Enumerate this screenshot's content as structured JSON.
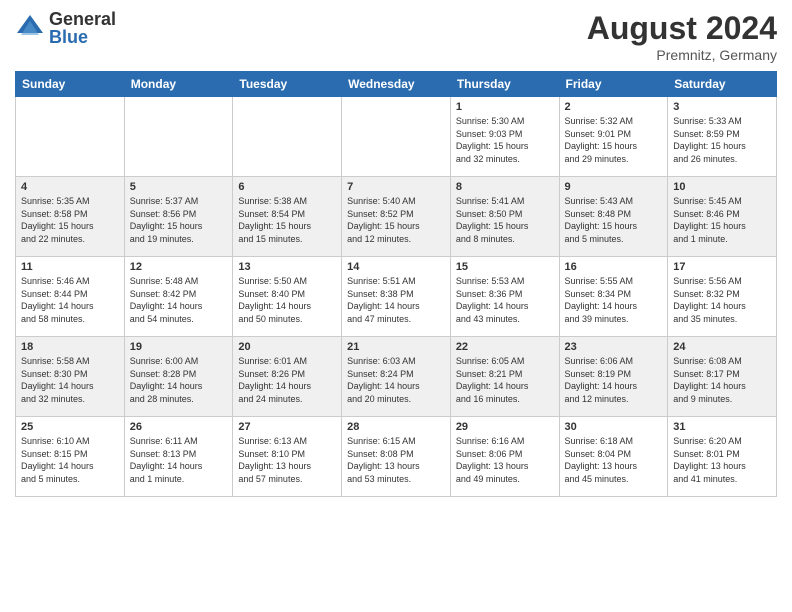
{
  "header": {
    "logo_general": "General",
    "logo_blue": "Blue",
    "month_year": "August 2024",
    "location": "Premnitz, Germany"
  },
  "weekdays": [
    "Sunday",
    "Monday",
    "Tuesday",
    "Wednesday",
    "Thursday",
    "Friday",
    "Saturday"
  ],
  "weeks": [
    [
      {
        "day": "",
        "info": ""
      },
      {
        "day": "",
        "info": ""
      },
      {
        "day": "",
        "info": ""
      },
      {
        "day": "",
        "info": ""
      },
      {
        "day": "1",
        "info": "Sunrise: 5:30 AM\nSunset: 9:03 PM\nDaylight: 15 hours\nand 32 minutes."
      },
      {
        "day": "2",
        "info": "Sunrise: 5:32 AM\nSunset: 9:01 PM\nDaylight: 15 hours\nand 29 minutes."
      },
      {
        "day": "3",
        "info": "Sunrise: 5:33 AM\nSunset: 8:59 PM\nDaylight: 15 hours\nand 26 minutes."
      }
    ],
    [
      {
        "day": "4",
        "info": "Sunrise: 5:35 AM\nSunset: 8:58 PM\nDaylight: 15 hours\nand 22 minutes."
      },
      {
        "day": "5",
        "info": "Sunrise: 5:37 AM\nSunset: 8:56 PM\nDaylight: 15 hours\nand 19 minutes."
      },
      {
        "day": "6",
        "info": "Sunrise: 5:38 AM\nSunset: 8:54 PM\nDaylight: 15 hours\nand 15 minutes."
      },
      {
        "day": "7",
        "info": "Sunrise: 5:40 AM\nSunset: 8:52 PM\nDaylight: 15 hours\nand 12 minutes."
      },
      {
        "day": "8",
        "info": "Sunrise: 5:41 AM\nSunset: 8:50 PM\nDaylight: 15 hours\nand 8 minutes."
      },
      {
        "day": "9",
        "info": "Sunrise: 5:43 AM\nSunset: 8:48 PM\nDaylight: 15 hours\nand 5 minutes."
      },
      {
        "day": "10",
        "info": "Sunrise: 5:45 AM\nSunset: 8:46 PM\nDaylight: 15 hours\nand 1 minute."
      }
    ],
    [
      {
        "day": "11",
        "info": "Sunrise: 5:46 AM\nSunset: 8:44 PM\nDaylight: 14 hours\nand 58 minutes."
      },
      {
        "day": "12",
        "info": "Sunrise: 5:48 AM\nSunset: 8:42 PM\nDaylight: 14 hours\nand 54 minutes."
      },
      {
        "day": "13",
        "info": "Sunrise: 5:50 AM\nSunset: 8:40 PM\nDaylight: 14 hours\nand 50 minutes."
      },
      {
        "day": "14",
        "info": "Sunrise: 5:51 AM\nSunset: 8:38 PM\nDaylight: 14 hours\nand 47 minutes."
      },
      {
        "day": "15",
        "info": "Sunrise: 5:53 AM\nSunset: 8:36 PM\nDaylight: 14 hours\nand 43 minutes."
      },
      {
        "day": "16",
        "info": "Sunrise: 5:55 AM\nSunset: 8:34 PM\nDaylight: 14 hours\nand 39 minutes."
      },
      {
        "day": "17",
        "info": "Sunrise: 5:56 AM\nSunset: 8:32 PM\nDaylight: 14 hours\nand 35 minutes."
      }
    ],
    [
      {
        "day": "18",
        "info": "Sunrise: 5:58 AM\nSunset: 8:30 PM\nDaylight: 14 hours\nand 32 minutes."
      },
      {
        "day": "19",
        "info": "Sunrise: 6:00 AM\nSunset: 8:28 PM\nDaylight: 14 hours\nand 28 minutes."
      },
      {
        "day": "20",
        "info": "Sunrise: 6:01 AM\nSunset: 8:26 PM\nDaylight: 14 hours\nand 24 minutes."
      },
      {
        "day": "21",
        "info": "Sunrise: 6:03 AM\nSunset: 8:24 PM\nDaylight: 14 hours\nand 20 minutes."
      },
      {
        "day": "22",
        "info": "Sunrise: 6:05 AM\nSunset: 8:21 PM\nDaylight: 14 hours\nand 16 minutes."
      },
      {
        "day": "23",
        "info": "Sunrise: 6:06 AM\nSunset: 8:19 PM\nDaylight: 14 hours\nand 12 minutes."
      },
      {
        "day": "24",
        "info": "Sunrise: 6:08 AM\nSunset: 8:17 PM\nDaylight: 14 hours\nand 9 minutes."
      }
    ],
    [
      {
        "day": "25",
        "info": "Sunrise: 6:10 AM\nSunset: 8:15 PM\nDaylight: 14 hours\nand 5 minutes."
      },
      {
        "day": "26",
        "info": "Sunrise: 6:11 AM\nSunset: 8:13 PM\nDaylight: 14 hours\nand 1 minute."
      },
      {
        "day": "27",
        "info": "Sunrise: 6:13 AM\nSunset: 8:10 PM\nDaylight: 13 hours\nand 57 minutes."
      },
      {
        "day": "28",
        "info": "Sunrise: 6:15 AM\nSunset: 8:08 PM\nDaylight: 13 hours\nand 53 minutes."
      },
      {
        "day": "29",
        "info": "Sunrise: 6:16 AM\nSunset: 8:06 PM\nDaylight: 13 hours\nand 49 minutes."
      },
      {
        "day": "30",
        "info": "Sunrise: 6:18 AM\nSunset: 8:04 PM\nDaylight: 13 hours\nand 45 minutes."
      },
      {
        "day": "31",
        "info": "Sunrise: 6:20 AM\nSunset: 8:01 PM\nDaylight: 13 hours\nand 41 minutes."
      }
    ]
  ]
}
